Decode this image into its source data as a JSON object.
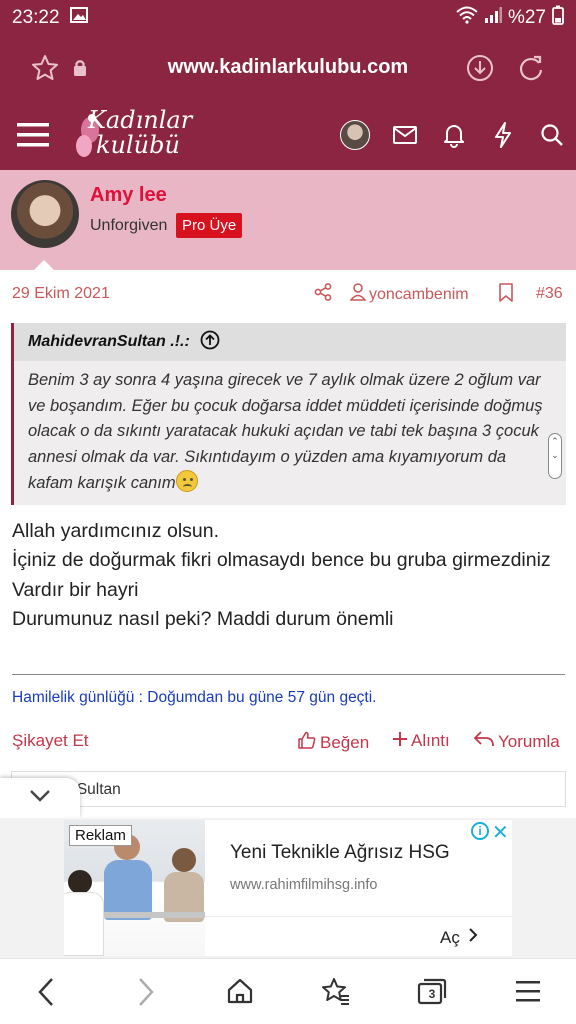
{
  "status_bar": {
    "time": "23:22",
    "battery": "%27"
  },
  "browser": {
    "url": "www.kadinlarkulubu.com"
  },
  "site": {
    "logo_line1": "Kadınlar",
    "logo_line2": "kulübü"
  },
  "profile": {
    "name": "Amy lee",
    "title": "Unforgiven",
    "badge": "Pro Üye"
  },
  "post": {
    "date": "29 Ekim 2021",
    "author": "yoncambenim",
    "number": "#36",
    "quote": {
      "author": "MahidevranSultan .!.:",
      "text": "Benim 3 ay sonra 4 yaşına girecek ve 7 aylık olmak üzere 2 oğlum var ve boşandım. Eğer bu çocuk doğarsa iddet müddeti içerisinde doğmuş olacak o da sıkıntı yaratacak hukuki açıdan ve tabi tek başına 3 çocuk annesi olmak da var. Sıkıntıdayım o yüzden ama kıyamıyorum da kafam karışık canım"
    },
    "message_lines": [
      "Allah yardımcınız olsun.",
      "İçiniz de doğurmak fikri olmasaydı bence bu gruba girmezdiniz",
      "Vardır bir hayri",
      "Durumunuz nasıl peki? Maddi durum önemli"
    ],
    "signature": "Hamilelik günlüğü : Doğumdan bu güne 57 gün geçti."
  },
  "actions": {
    "report": "Şikayet Et",
    "like": "Beğen",
    "quote": "Alıntı",
    "reply": "Yorumla"
  },
  "reaction": {
    "text": "idevranSultan"
  },
  "ad": {
    "tag": "Reklam",
    "headline": "Yeni Teknikle Ağrısız HSG",
    "url": "www.rahimfilmihsg.info",
    "open_label": "Aç"
  },
  "bottom_nav": {
    "tab_count": "3"
  },
  "colors": {
    "brand": "#8c2541",
    "profile_bg": "#e8b6c4",
    "accent_red": "#e0103a",
    "link_blue": "#1a3cbc"
  }
}
